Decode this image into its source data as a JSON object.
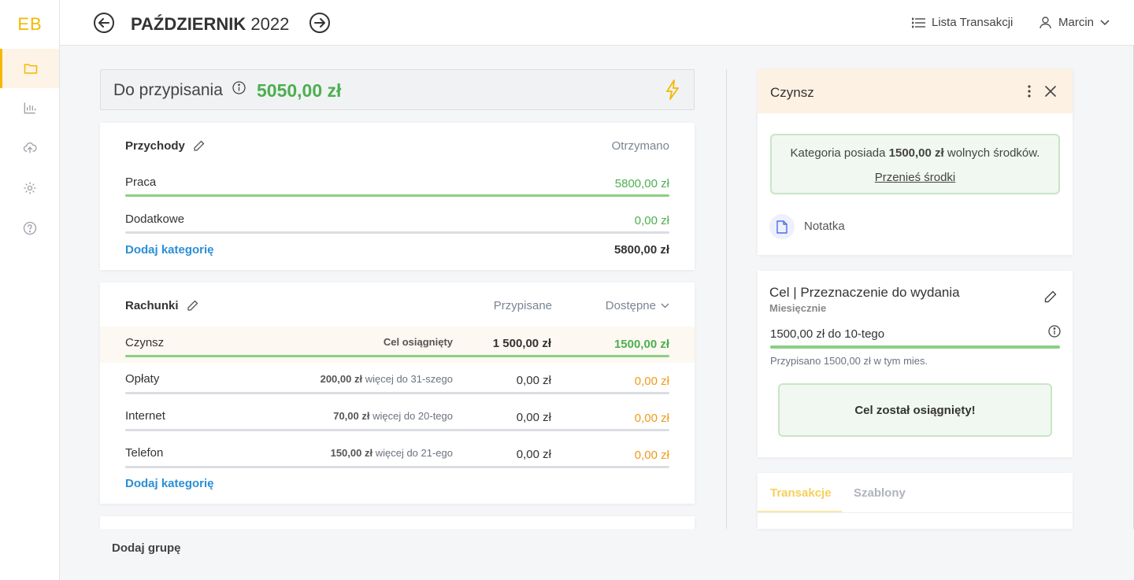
{
  "sidebar": {
    "logo": "EB"
  },
  "header": {
    "month": "PAŹDZIERNIK",
    "year": "2022",
    "transactions_link": "Lista Transakcji",
    "user": "Marcin"
  },
  "assign": {
    "label": "Do przypisania",
    "amount": "5050,00 zł"
  },
  "income": {
    "title": "Przychody",
    "col_received": "Otrzymano",
    "rows": [
      {
        "name": "Praca",
        "value": "5800,00 zł"
      },
      {
        "name": "Dodatkowe",
        "value": "0,00 zł"
      }
    ],
    "add_category": "Dodaj kategorię",
    "total": "5800,00 zł"
  },
  "bills": {
    "title": "Rachunki",
    "col_assigned": "Przypisane",
    "col_available": "Dostępne",
    "rows": [
      {
        "name": "Czynsz",
        "note_amount": "",
        "note_text": "Cel osiągnięty",
        "assigned": "1 500,00 zł",
        "available": "1500,00 zł"
      },
      {
        "name": "Opłaty",
        "note_amount": "200,00 zł",
        "note_text": " więcej do 31-szego",
        "assigned": "0,00 zł",
        "available": "0,00 zł"
      },
      {
        "name": "Internet",
        "note_amount": "70,00 zł",
        "note_text": " więcej do 20-tego",
        "assigned": "0,00 zł",
        "available": "0,00 zł"
      },
      {
        "name": "Telefon",
        "note_amount": "150,00 zł",
        "note_text": " więcej do 21-ego",
        "assigned": "0,00 zł",
        "available": "0,00 zł"
      }
    ],
    "add_category": "Dodaj kategorię"
  },
  "add_group": "Dodaj grupę",
  "panel": {
    "title": "Czynsz",
    "info_pre": "Kategoria posiada ",
    "info_amount": "1500,00 zł",
    "info_post": " wolnych środków.",
    "move_funds": "Przenieś środki",
    "note_label": "Notatka",
    "goal_title": "Cel | Przeznaczenie do wydania",
    "goal_freq": "Miesięcznie",
    "goal_target": "1500,00 zł do 10-tego",
    "goal_progress": 1.0,
    "goal_assigned": "Przypisano 1500,00 zł w tym mies.",
    "goal_done": "Cel został osiągnięty!",
    "tabs": [
      "Transakcje",
      "Szablony"
    ]
  },
  "colors": {
    "accent": "#f5b800",
    "positive": "#4caf50",
    "warning": "#f09a1a",
    "link": "#2a8fd6"
  }
}
